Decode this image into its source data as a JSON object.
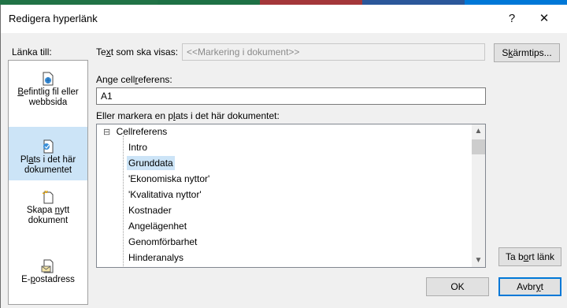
{
  "dialog": {
    "title": "Redigera hyperlänk",
    "help_glyph": "?",
    "close_glyph": "✕"
  },
  "nav": {
    "heading": "Länka till:",
    "items": [
      {
        "label_pre": "",
        "label_u": "B",
        "label_post": "efintlig fil eller webbsida",
        "icon": "web-page-icon",
        "selected": false
      },
      {
        "label_pre": "Pl",
        "label_u": "a",
        "label_post": "ts i det här dokumentet",
        "icon": "place-in-document-icon",
        "selected": true
      },
      {
        "label_pre": "Skapa ",
        "label_u": "n",
        "label_post": "ytt dokument",
        "icon": "new-document-icon",
        "selected": false
      },
      {
        "label_pre": "E-",
        "label_u": "p",
        "label_post": "ostadress",
        "icon": "email-address-icon",
        "selected": false
      }
    ]
  },
  "display_text": {
    "label_pre": "Te",
    "label_u": "x",
    "label_post": "t som ska visas:",
    "value": "<<Markering i dokument>>"
  },
  "screentip_button": {
    "label_pre": "S",
    "label_u": "k",
    "label_post": "ärmtips..."
  },
  "cell_ref": {
    "label_pre": "Ange cell",
    "label_u": "r",
    "label_post": "eferens:",
    "value": "A1"
  },
  "place_list": {
    "label_pre": "Eller markera en p",
    "label_u": "l",
    "label_post": "ats i det här dokumentet:",
    "root": "Cellreferens",
    "root_toggle": "⊟",
    "items": [
      "Intro",
      "Grunddata",
      "'Ekonomiska nyttor'",
      "'Kvalitativa nyttor'",
      "Kostnader",
      "Angelägenhet",
      "Genomförbarhet",
      "Hinderanalys"
    ],
    "selected_index": 1
  },
  "remove_link_button": {
    "label_pre": "Ta b",
    "label_u": "o",
    "label_post": "rt länk"
  },
  "ok_button": {
    "label": "OK"
  },
  "cancel_button": {
    "label_pre": "Avbr",
    "label_u": "y",
    "label_post": "t"
  },
  "colors": {
    "selection": "#cce4f7",
    "accent": "#0078d7",
    "strip": [
      "#217346",
      "#1e7145",
      "#a4373a",
      "#2b579a",
      "#0078d7"
    ]
  }
}
